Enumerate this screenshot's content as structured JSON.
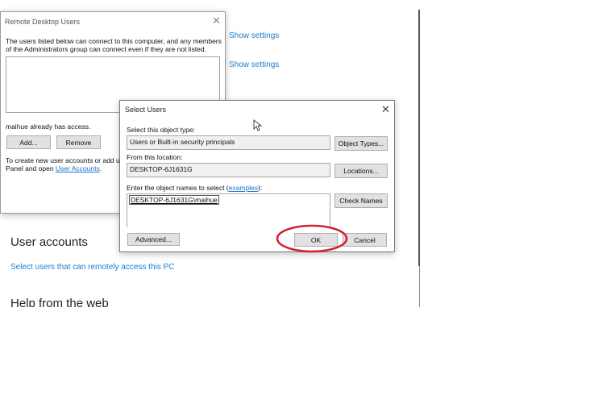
{
  "remote_dialog": {
    "title": "Remote Desktop Users",
    "description": "The users listed below can connect to this computer, and any members of the Administrators group can connect even if they are not listed.",
    "access_text": "maihue already has access.",
    "add_label": "Add...",
    "remove_label": "Remove",
    "footer_line1": "To create new user accounts or add use",
    "footer_line2_prefix": "Panel and open ",
    "footer_link": "User Accounts",
    "footer_suffix": "."
  },
  "settings_links": [
    "Show settings",
    "Show settings"
  ],
  "select_dialog": {
    "title": "Select Users",
    "object_type_label": "Select this object type:",
    "object_type_value": "Users or Built-in security principals",
    "object_types_button": "Object Types...",
    "location_label": "From this location:",
    "location_value": "DESKTOP-6J1631G",
    "locations_button": "Locations...",
    "names_label": "Enter the object names to select (",
    "examples_link": "examples",
    "names_label_suffix": "):",
    "names_value": "DESKTOP-6J1631G\\maihue",
    "check_names_button": "Check Names",
    "advanced_button": "Advanced...",
    "ok_button": "OK",
    "cancel_button": "Cancel"
  },
  "page": {
    "user_accounts_heading": "User accounts",
    "remote_access_link": "Select users that can remotely access this PC",
    "help_heading": "Help from the web"
  },
  "colors": {
    "link": "#1a7fd0",
    "highlight_circle": "#d0202a"
  }
}
